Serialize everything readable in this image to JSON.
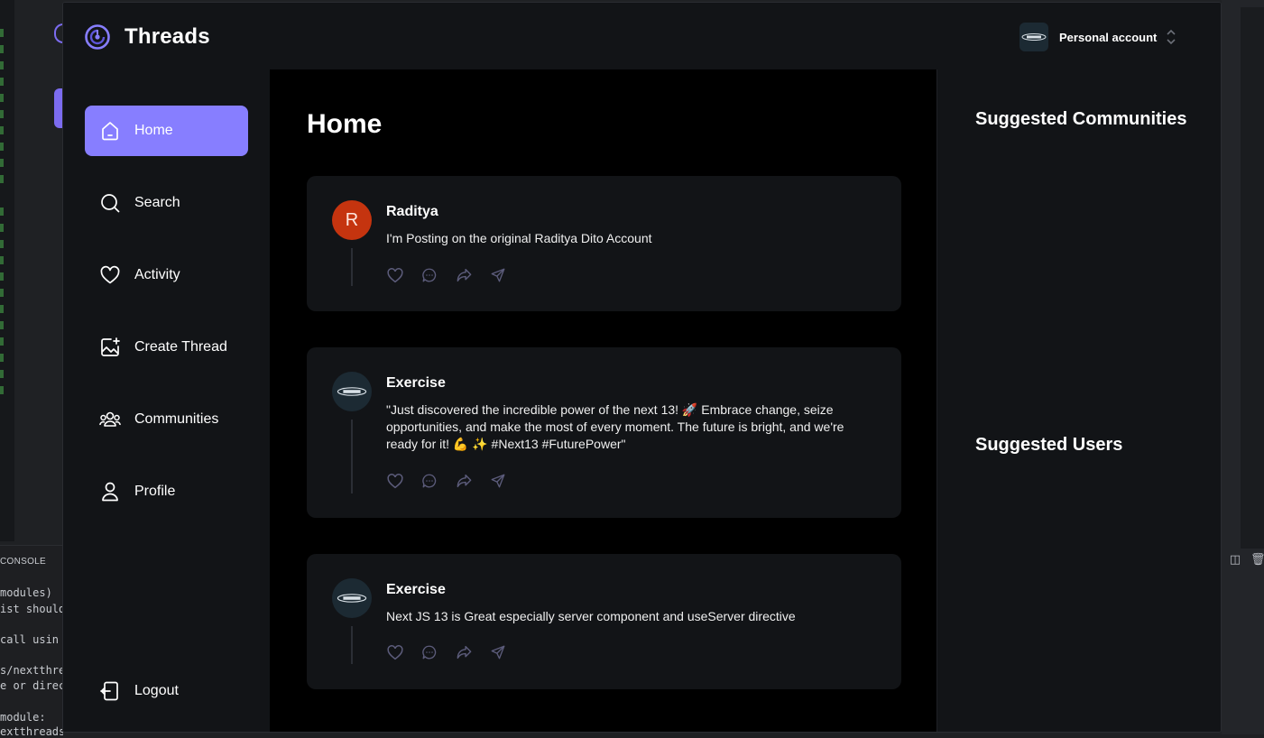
{
  "app": {
    "brand": "Threads",
    "account_label": "Personal account"
  },
  "sidebar": {
    "items": [
      {
        "label": "Home",
        "icon": "home-icon",
        "active": true
      },
      {
        "label": "Search",
        "icon": "search-icon",
        "active": false
      },
      {
        "label": "Activity",
        "icon": "heart-icon",
        "active": false
      },
      {
        "label": "Create Thread",
        "icon": "create-thread-icon",
        "active": false
      },
      {
        "label": "Communities",
        "icon": "communities-icon",
        "active": false
      },
      {
        "label": "Profile",
        "icon": "profile-icon",
        "active": false
      }
    ],
    "logout_label": "Logout"
  },
  "main": {
    "title": "Home",
    "threads": [
      {
        "author": "Raditya",
        "avatar_letter": "R",
        "text": "I'm Posting on the original Raditya Dito Account"
      },
      {
        "author": "Exercise",
        "avatar_letter": "",
        "text": "\"Just discovered the incredible power of the next 13! 🚀 Embrace change, seize opportunities, and make the most of every moment. The future is bright, and we're ready for it! 💪 ✨ #Next13 #FuturePower\""
      },
      {
        "author": "Exercise",
        "avatar_letter": "",
        "text": "Next JS 13 is Great especially server component and useServer directive"
      }
    ]
  },
  "rightbar": {
    "communities_heading": "Suggested Communities",
    "users_heading": "Suggested Users"
  },
  "background": {
    "console_title": "CONSOLE",
    "console_lines": [
      "modules)",
      "ist should",
      "",
      " call usin",
      "",
      "s/nextthre",
      "e or direc",
      "",
      " module:",
      "extthreads"
    ]
  },
  "colors": {
    "accent": "#877eff",
    "surface": "#121417",
    "feed_bg": "#000000",
    "avatar_red": "#c5340f"
  }
}
